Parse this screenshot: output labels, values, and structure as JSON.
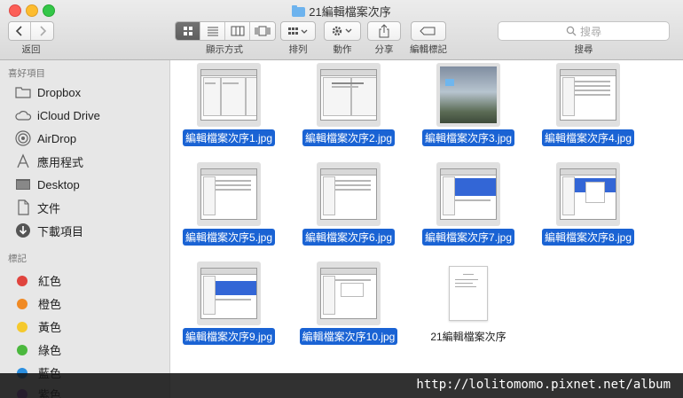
{
  "window": {
    "title": "21編輯檔案次序"
  },
  "toolbar": {
    "back_label": "返回",
    "view_label": "顯示方式",
    "arrange_label": "排列",
    "action_label": "動作",
    "share_label": "分享",
    "tags_label": "編輯標記",
    "search_label": "搜尋",
    "search_placeholder": "搜尋"
  },
  "sidebar": {
    "favorites_header": "喜好項目",
    "favorites": [
      {
        "label": "Dropbox",
        "icon": "folder-icon"
      },
      {
        "label": "iCloud Drive",
        "icon": "cloud-icon"
      },
      {
        "label": "AirDrop",
        "icon": "airdrop-icon"
      },
      {
        "label": "應用程式",
        "icon": "applications-icon"
      },
      {
        "label": "Desktop",
        "icon": "desktop-icon"
      },
      {
        "label": "文件",
        "icon": "document-icon"
      },
      {
        "label": "下載項目",
        "icon": "download-icon"
      }
    ],
    "tags_header": "標記",
    "tags": [
      {
        "label": "紅色",
        "color": "#e0443e"
      },
      {
        "label": "橙色",
        "color": "#f08a24"
      },
      {
        "label": "黃色",
        "color": "#f5c92d"
      },
      {
        "label": "綠色",
        "color": "#4bb83e"
      },
      {
        "label": "藍色",
        "color": "#2b8fe0"
      },
      {
        "label": "紫色",
        "color": "#a25ad6"
      }
    ]
  },
  "files": [
    {
      "name": "編輯檔案次序1.jpg",
      "selected": true
    },
    {
      "name": "編輯檔案次序2.jpg",
      "selected": true
    },
    {
      "name": "編輯檔案次序3.jpg",
      "selected": true
    },
    {
      "name": "編輯檔案次序4.jpg",
      "selected": true
    },
    {
      "name": "編輯檔案次序5.jpg",
      "selected": true
    },
    {
      "name": "編輯檔案次序6.jpg",
      "selected": true
    },
    {
      "name": "編輯檔案次序7.jpg",
      "selected": true
    },
    {
      "name": "編輯檔案次序8.jpg",
      "selected": true
    },
    {
      "name": "編輯檔案次序9.jpg",
      "selected": true
    },
    {
      "name": "編輯檔案次序10.jpg",
      "selected": true
    },
    {
      "name": "21編輯檔案次序",
      "selected": false
    }
  ],
  "watermark": "http://lolitomomo.pixnet.net/album",
  "colors": {
    "selection": "#1a63d4",
    "sidebar_bg": "#e7e7e7"
  }
}
